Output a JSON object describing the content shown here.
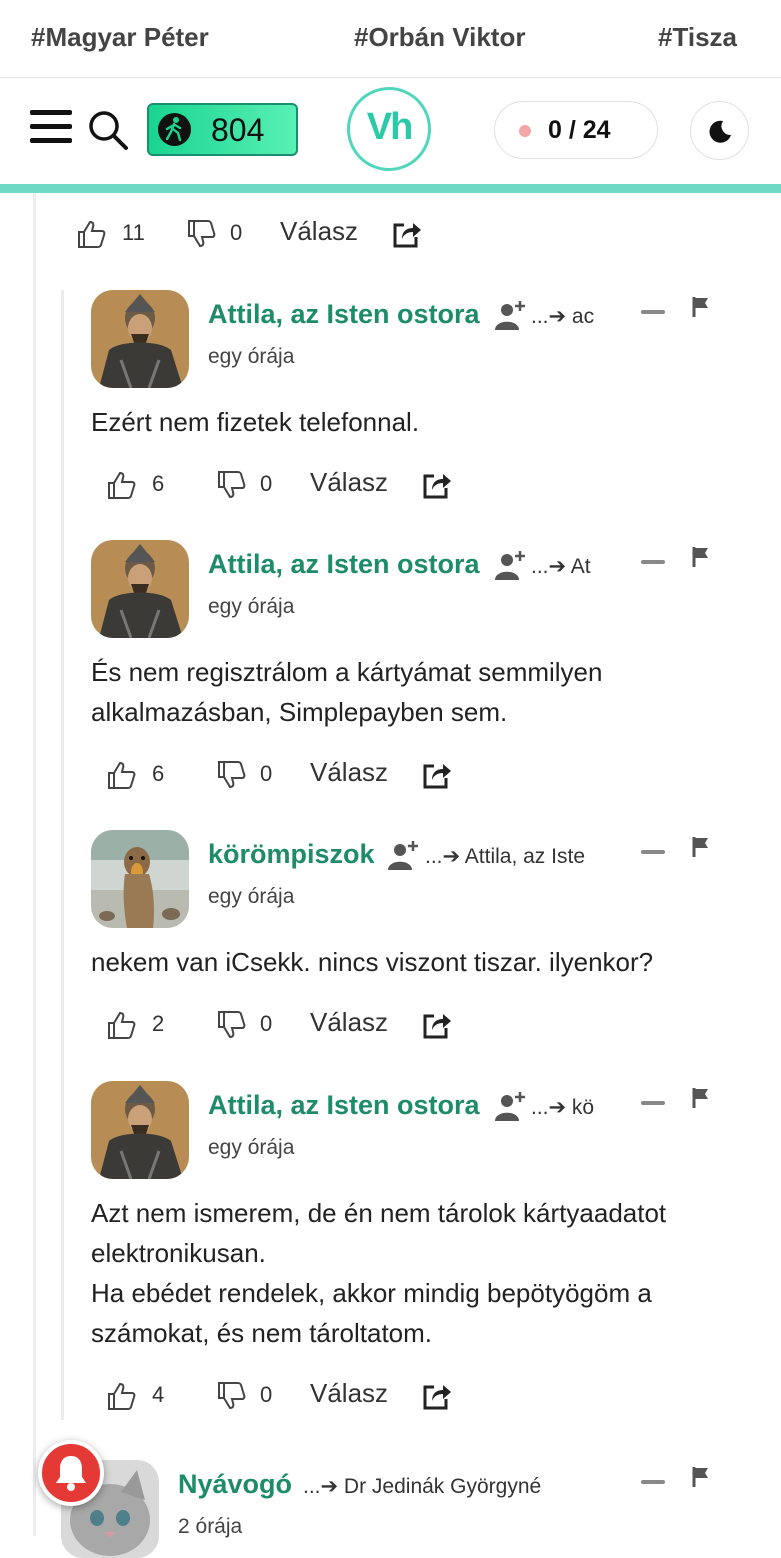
{
  "topics": [
    "#Magyar Péter",
    "#Orbán Viktor",
    "#Tisza"
  ],
  "header": {
    "visitor_count": "804",
    "logo_text": "Vh",
    "unread": "0 / 24",
    "accent_color": "#4fd6bd"
  },
  "first_actions": {
    "likes": "11",
    "dislikes": "0",
    "reply_label": "Válasz"
  },
  "comments": [
    {
      "author": "Attila, az Isten ostora",
      "reply_to": "...➔ ac",
      "time": "egy órája",
      "text": "Ezért nem fizetek telefonnal.",
      "likes": "6",
      "dislikes": "0",
      "reply_label": "Válasz"
    },
    {
      "author": "Attila, az Isten ostora",
      "reply_to": "...➔ At",
      "time": "egy órája",
      "text": "És nem regisztrálom a kártyámat semmilyen alkalmazásban, Simplepayben sem.",
      "likes": "6",
      "dislikes": "0",
      "reply_label": "Válasz"
    },
    {
      "author": "körömpiszok",
      "reply_to": "...➔ Attila, az Iste",
      "time": "egy órája",
      "text": "nekem van iCsekk. nincs viszont tiszar. ilyenkor?",
      "likes": "2",
      "dislikes": "0",
      "reply_label": "Válasz"
    },
    {
      "author": "Attila, az Isten ostora",
      "reply_to": "...➔ kö",
      "time": "egy órája",
      "text": "Azt nem ismerem, de én nem tárolok kártyaadatot elektronikusan.\nHa ebédet rendelek, akkor mindig bepötyögöm a számokat, és nem tároltatom.",
      "likes": "4",
      "dislikes": "0",
      "reply_label": "Válasz"
    },
    {
      "author": "Nyávogó",
      "reply_to": "...➔ Dr Jedinák Györgyné",
      "time": "2 órája"
    }
  ]
}
